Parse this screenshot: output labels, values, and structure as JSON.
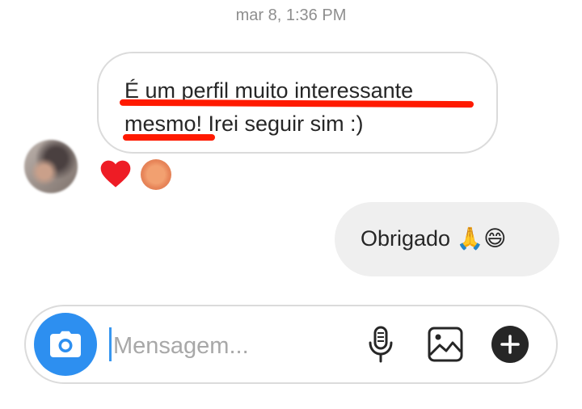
{
  "timestamp": "mar 8, 1:36 PM",
  "messages": {
    "incoming": {
      "line1": "É um perfil muito interessante",
      "line2": "mesmo! Irei seguir sim :)"
    },
    "outgoing": {
      "text": "Obrigado",
      "emojis": "🙏😄"
    }
  },
  "reactions": [
    "heart",
    "user-avatar"
  ],
  "annotation_color": "#ff1a00",
  "composer": {
    "placeholder": "Mensagem...",
    "icons": [
      "camera-icon",
      "microphone-icon",
      "gallery-icon",
      "plus-icon"
    ],
    "camera_color": "#2d8ff0"
  }
}
